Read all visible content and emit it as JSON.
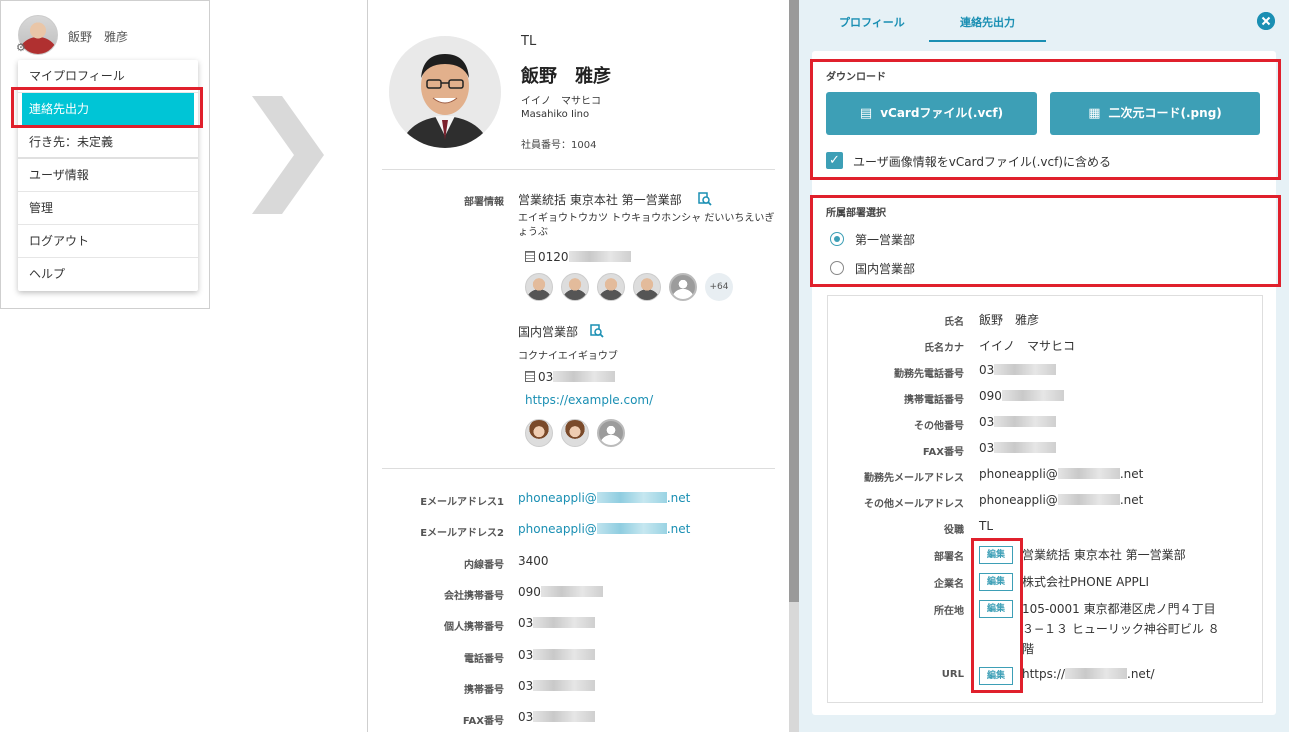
{
  "menu": {
    "user_name": "飯野　雅彦",
    "items": [
      {
        "label": "マイプロフィール"
      },
      {
        "label": "連絡先出力"
      },
      {
        "label": "行き先：未定義"
      },
      {
        "label": "ユーザ情報"
      },
      {
        "label": "管理"
      },
      {
        "label": "ログアウト"
      },
      {
        "label": "ヘルプ"
      }
    ]
  },
  "profile": {
    "title": "TL",
    "name": "飯野　雅彦",
    "kana": "イイノ　マサヒコ",
    "roman": "Masahiko Iino",
    "employee_no": "社員番号：1004",
    "dept_label": "部署情報",
    "dept1": {
      "name": "営業統括 東京本社 第一営業部",
      "kana": "エイギョウトウカツ トウキョウホンシャ だいいちえいぎょうぶ",
      "phone": "0120",
      "more_count": "+64"
    },
    "dept2": {
      "name": "国内営業部",
      "kana": "コクナイエイギョウブ",
      "phone": "03",
      "url": "https://example.com/"
    },
    "contacts": [
      {
        "label": "Eメールアドレス1",
        "value": "phoneappli@",
        "suffix": ".net"
      },
      {
        "label": "Eメールアドレス2",
        "value": "phoneappli@",
        "suffix": ".net"
      },
      {
        "label": "内線番号",
        "value": "3400"
      },
      {
        "label": "会社携帯番号",
        "value": "090"
      },
      {
        "label": "個人携帯番号",
        "value": "03"
      },
      {
        "label": "電話番号",
        "value": "03"
      },
      {
        "label": "携帯番号",
        "value": "03"
      },
      {
        "label": "FAX番号",
        "value": "03"
      }
    ]
  },
  "export": {
    "tabs": [
      {
        "label": "プロフィール"
      },
      {
        "label": "連絡先出力"
      }
    ],
    "download_title": "ダウンロード",
    "vcard_button": "vCardファイル(.vcf)",
    "qr_button": "二次元コード(.png)",
    "include_image_label": "ユーザ画像情報をvCardファイル(.vcf)に含める",
    "dept_select_title": "所属部署選択",
    "dept_options": [
      {
        "label": "第一営業部"
      },
      {
        "label": "国内営業部"
      }
    ],
    "edit_label": "編集",
    "fields": [
      {
        "label": "氏名",
        "value": "飯野　雅彦"
      },
      {
        "label": "氏名カナ",
        "value": "イイノ　マサヒコ"
      },
      {
        "label": "勤務先電話番号",
        "value": "03"
      },
      {
        "label": "携帯電話番号",
        "value": "090"
      },
      {
        "label": "その他番号",
        "value": "03"
      },
      {
        "label": "FAX番号",
        "value": "03"
      },
      {
        "label": "勤務先メールアドレス",
        "value": "phoneappli@",
        "suffix": ".net"
      },
      {
        "label": "その他メールアドレス",
        "value": "phoneappli@",
        "suffix": ".net"
      },
      {
        "label": "役職",
        "value": "TL"
      },
      {
        "label": "部署名",
        "value": "営業統括 東京本社 第一営業部"
      },
      {
        "label": "企業名",
        "value": "株式会社PHONE APPLI"
      },
      {
        "label": "所在地",
        "value": "105-0001 東京都港区虎ノ門４丁目",
        "value2": "３−１３ ヒューリック神谷町ビル ８",
        "value3": "階"
      },
      {
        "label": "URL",
        "value": "https://",
        "suffix": ".net/"
      }
    ]
  },
  "colors": {
    "accent": "#00c5d6",
    "primary": "#3d9fb6",
    "link": "#1a8fb3",
    "highlight": "#e0202c"
  }
}
